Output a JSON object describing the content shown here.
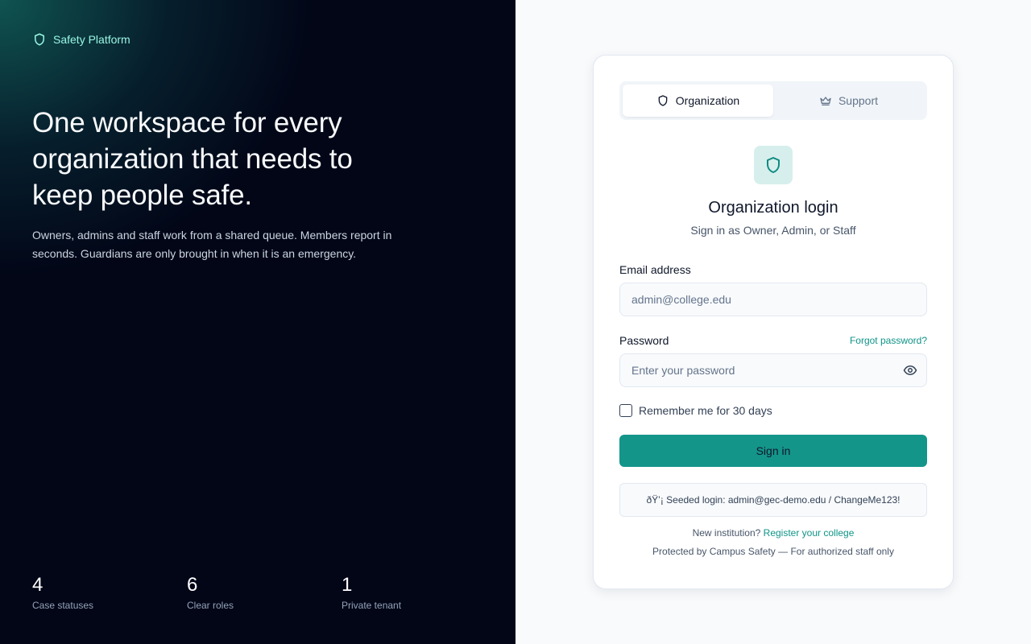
{
  "brand": {
    "name": "Safety Platform",
    "icon": "shield-icon"
  },
  "hero": {
    "title": "One workspace for every organization that needs to keep people safe.",
    "description": "Owners, admins and staff work from a shared queue. Members report in seconds. Guardians are only brought in when it is an emergency.",
    "stats": [
      {
        "value": "4",
        "label": "Case statuses"
      },
      {
        "value": "6",
        "label": "Clear roles"
      },
      {
        "value": "1",
        "label": "Private tenant"
      }
    ]
  },
  "tabs": [
    {
      "label": "Organization",
      "icon": "shield-icon",
      "active": true
    },
    {
      "label": "Support",
      "icon": "crown-icon",
      "active": false
    }
  ],
  "login": {
    "title": "Organization login",
    "subtitle": "Sign in as Owner, Admin, or Staff",
    "email_label": "Email address",
    "email_placeholder": "admin@college.edu",
    "password_label": "Password",
    "forgot_link": "Forgot password?",
    "password_placeholder": "Enter your password",
    "remember_label": "Remember me for 30 days",
    "signin_label": "Sign in",
    "seed_note": "ðŸ’¡ Seeded login: admin@gec-demo.edu / ChangeMe123!",
    "new_institution_text": "New institution?",
    "register_link": "Register your college",
    "protected_text": "Protected by Campus Safety — For authorized staff only"
  },
  "colors": {
    "accent": "#14958a",
    "hero_bg": "#020617",
    "brand_text": "#99f6e4"
  }
}
